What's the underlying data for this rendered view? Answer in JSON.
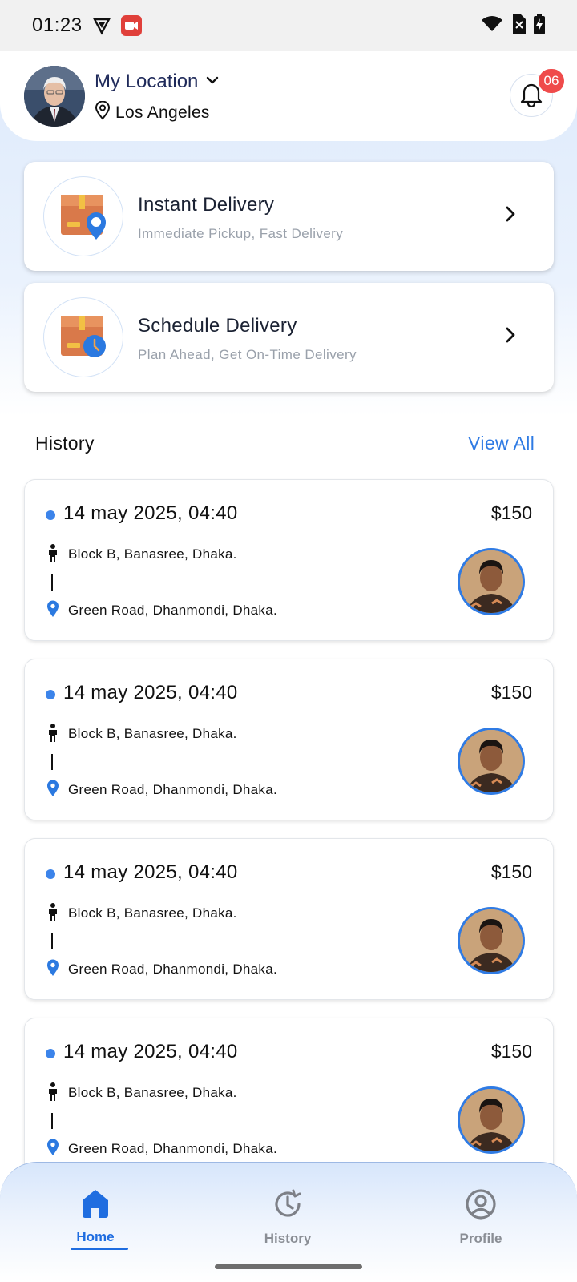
{
  "status_bar": {
    "time": "01:23"
  },
  "header": {
    "location_label": "My Location",
    "city": "Los Angeles",
    "notification_count": "06"
  },
  "delivery_options": [
    {
      "title": "Instant Delivery",
      "subtitle": "Immediate Pickup, Fast Delivery",
      "icon": "box-location-icon"
    },
    {
      "title": "Schedule Delivery",
      "subtitle": "Plan Ahead, Get On-Time Delivery",
      "icon": "box-clock-icon"
    }
  ],
  "history": {
    "title": "History",
    "view_all": "View All",
    "items": [
      {
        "date": "14 may 2025, 04:40",
        "price": "$150",
        "pickup": "Block B, Banasree, Dhaka.",
        "dropoff": "Green Road, Dhanmondi, Dhaka."
      },
      {
        "date": "14 may 2025, 04:40",
        "price": "$150",
        "pickup": "Block B, Banasree, Dhaka.",
        "dropoff": "Green Road, Dhanmondi, Dhaka."
      },
      {
        "date": "14 may 2025, 04:40",
        "price": "$150",
        "pickup": "Block B, Banasree, Dhaka.",
        "dropoff": "Green Road, Dhanmondi, Dhaka."
      },
      {
        "date": "14 may 2025, 04:40",
        "price": "$150",
        "pickup": "Block B, Banasree, Dhaka.",
        "dropoff": "Green Road, Dhanmondi, Dhaka."
      }
    ]
  },
  "bottom_nav": {
    "items": [
      {
        "label": "Home",
        "icon": "home-icon",
        "active": true
      },
      {
        "label": "History",
        "icon": "history-icon",
        "active": false
      },
      {
        "label": "Profile",
        "icon": "profile-icon",
        "active": false
      }
    ]
  },
  "colors": {
    "accent": "#2f7be4",
    "badge": "#ef4b4b",
    "active_nav": "#1f6de0",
    "inactive_nav": "#8a8e95"
  }
}
